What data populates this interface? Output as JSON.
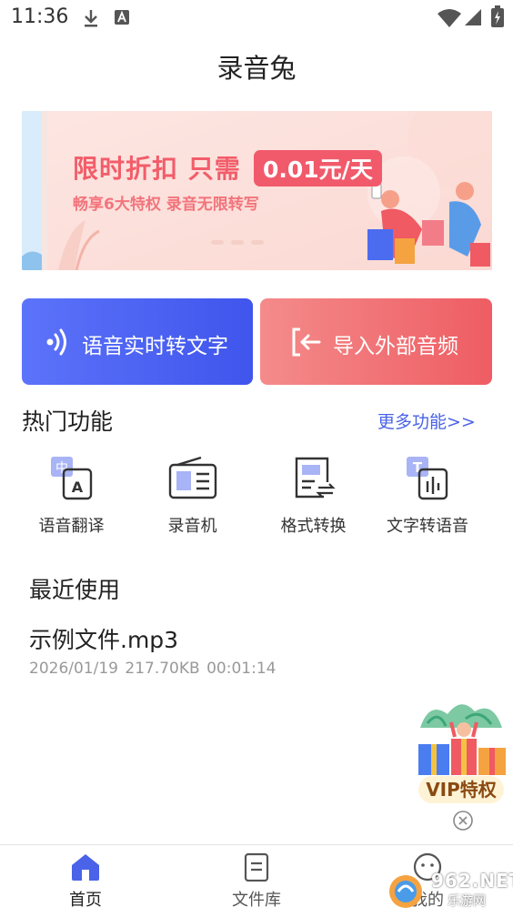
{
  "status_bar": {
    "time": "11:36"
  },
  "header": {
    "title": "录音兔"
  },
  "banner": {
    "headline": "限时折扣 只需",
    "price": "0.01元/天",
    "subtitle": "畅享6大特权 录音无限转写"
  },
  "actions": {
    "left": {
      "label": "语音实时转文字",
      "icon": "audio-waves-icon"
    },
    "right": {
      "label": "导入外部音频",
      "icon": "import-icon"
    }
  },
  "hot": {
    "title": "热门功能",
    "more": "更多功能>>",
    "items": [
      {
        "label": "语音翻译",
        "icon": "translate-icon"
      },
      {
        "label": "录音机",
        "icon": "recorder-icon"
      },
      {
        "label": "格式转换",
        "icon": "format-convert-icon"
      },
      {
        "label": "文字转语音",
        "icon": "text-to-speech-icon"
      }
    ]
  },
  "recent": {
    "title": "最近使用",
    "file": {
      "name": "示例文件.mp3",
      "date": "2026/01/19",
      "size": "217.70KB",
      "duration": "00:01:14"
    }
  },
  "vip": {
    "label": "VIP特权"
  },
  "tabbar": {
    "items": [
      {
        "label": "首页",
        "active": true
      },
      {
        "label": "文件库",
        "active": false
      },
      {
        "label": "我的",
        "active": false
      }
    ]
  },
  "watermark": {
    "text1": "962.NET",
    "text2": "乐游网"
  },
  "colors": {
    "primary": "#4a63e8",
    "coral": "#ee5d63",
    "banner_pink": "#f25d6a"
  }
}
